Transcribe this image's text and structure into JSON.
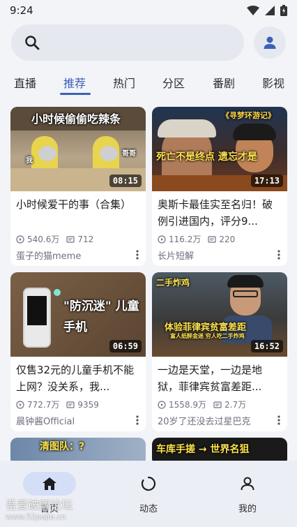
{
  "status_bar": {
    "time": "9:24"
  },
  "tabs": [
    {
      "label": "直播"
    },
    {
      "label": "推荐"
    },
    {
      "label": "热门"
    },
    {
      "label": "分区"
    },
    {
      "label": "番剧"
    },
    {
      "label": "影视"
    }
  ],
  "active_tab": "推荐",
  "accent_color": "#3d60b8",
  "videos": [
    {
      "thumb_text": "小时候偷偷吃辣条",
      "thumb_sub_left": "我",
      "thumb_sub_right": "哥哥",
      "duration": "08:15",
      "title": "小时候爱干的事（合集）",
      "views": "540.6万",
      "danmaku": "712",
      "channel": "蛋子的猫meme"
    },
    {
      "thumb_text": "死亡不是终点 遗忘才是",
      "thumb_tag": "《寻梦环游记》",
      "duration": "17:13",
      "title": "奥斯卡最佳实至名归！破例引进国内，评分9...",
      "views": "116.2万",
      "danmaku": "220",
      "channel": "长片短解"
    },
    {
      "thumb_text": "\"防沉迷\" 儿童手机",
      "duration": "06:59",
      "title": "仅售32元的儿童手机不能上网？没关系，我...",
      "views": "772.7万",
      "danmaku": "9359",
      "channel": "晨钟酱Official"
    },
    {
      "thumb_tag": "二手炸鸡",
      "thumb_text": "体验菲律宾贫富差距",
      "thumb_sub": "富人纸醉金迷 穷人吃二手炸鸡",
      "duration": "16:52",
      "title": "一边是天堂，一边是地狱，菲律宾贫富差距...",
      "views": "1558.9万",
      "danmaku": "2.7万",
      "channel": "20岁了还没去过星巴克"
    },
    {
      "thumb_text": "清图队：?"
    },
    {
      "thumb_text": "车库手搓 → 世界名狙"
    }
  ],
  "bottom_nav": [
    {
      "label": "首页",
      "icon": "home-icon"
    },
    {
      "label": "动态",
      "icon": "activity-icon"
    },
    {
      "label": "我的",
      "icon": "person-icon"
    }
  ],
  "watermark": {
    "line1": "吾爱破解论坛",
    "line2": "www.52pojie.cn"
  }
}
